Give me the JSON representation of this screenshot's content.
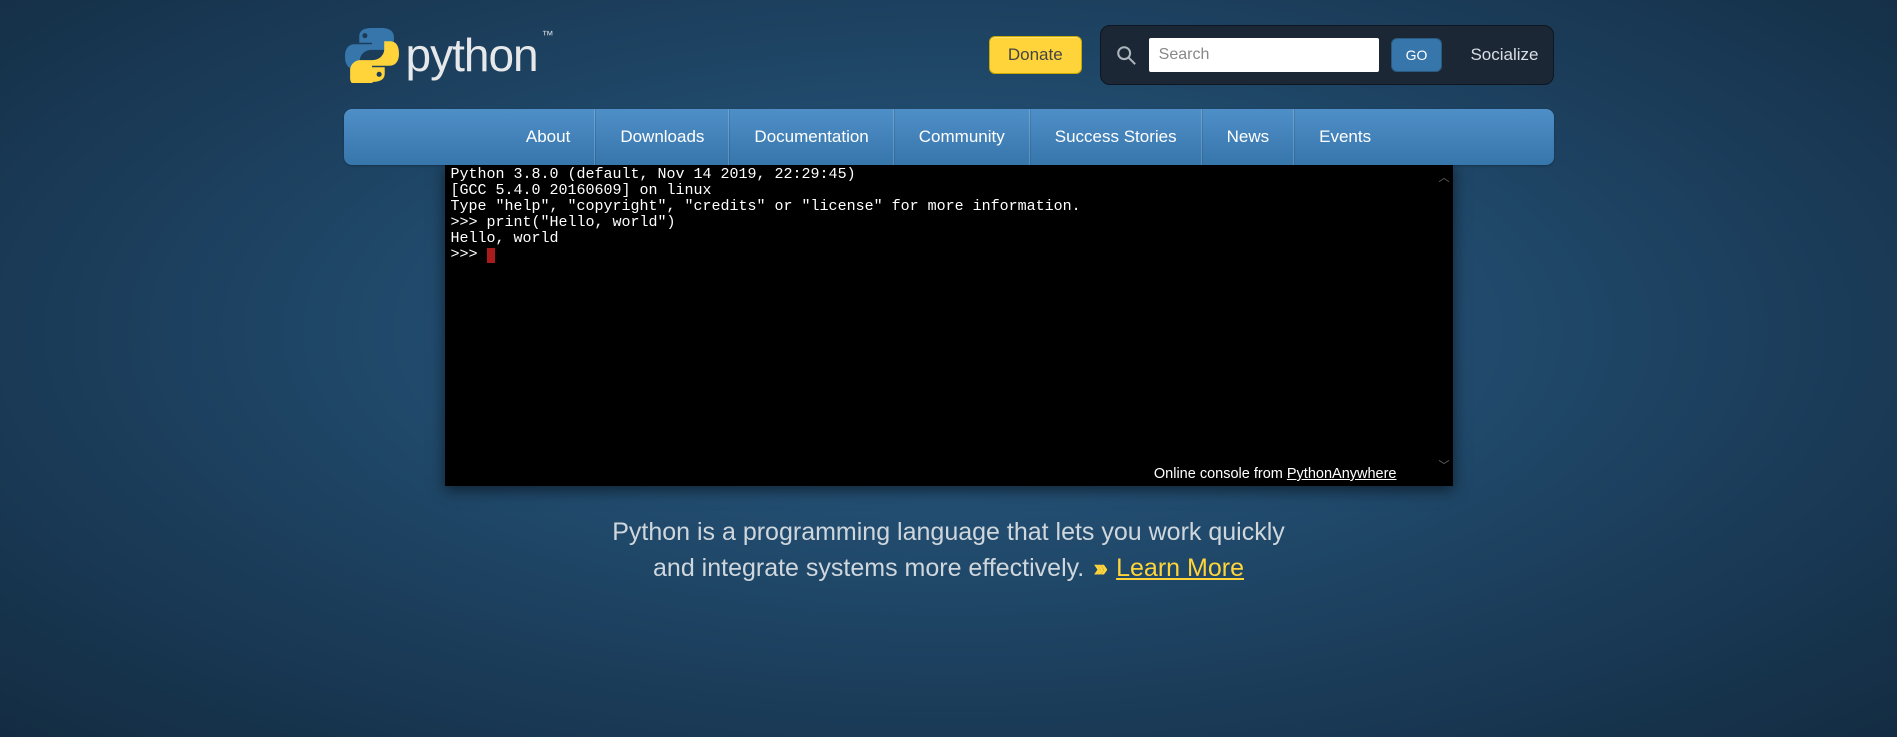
{
  "header": {
    "logo_text": "python",
    "tm": "™",
    "donate_label": "Donate",
    "search_placeholder": "Search",
    "go_label": "GO",
    "socialize_label": "Socialize"
  },
  "nav": {
    "items": [
      {
        "label": "About"
      },
      {
        "label": "Downloads"
      },
      {
        "label": "Documentation"
      },
      {
        "label": "Community"
      },
      {
        "label": "Success Stories"
      },
      {
        "label": "News"
      },
      {
        "label": "Events"
      }
    ]
  },
  "console": {
    "lines": [
      "Python 3.8.0 (default, Nov 14 2019, 22:29:45)",
      "[GCC 5.4.0 20160609] on linux",
      "Type \"help\", \"copyright\", \"credits\" or \"license\" for more information.",
      ">>> print(\"Hello, world\")",
      "Hello, world",
      ">>> "
    ],
    "footer_prefix": "Online console from ",
    "footer_link": "PythonAnywhere"
  },
  "tagline": {
    "line1": "Python is a programming language that lets you work quickly",
    "line2_before": "and integrate systems more effectively. ",
    "learn_more": "Learn More"
  }
}
